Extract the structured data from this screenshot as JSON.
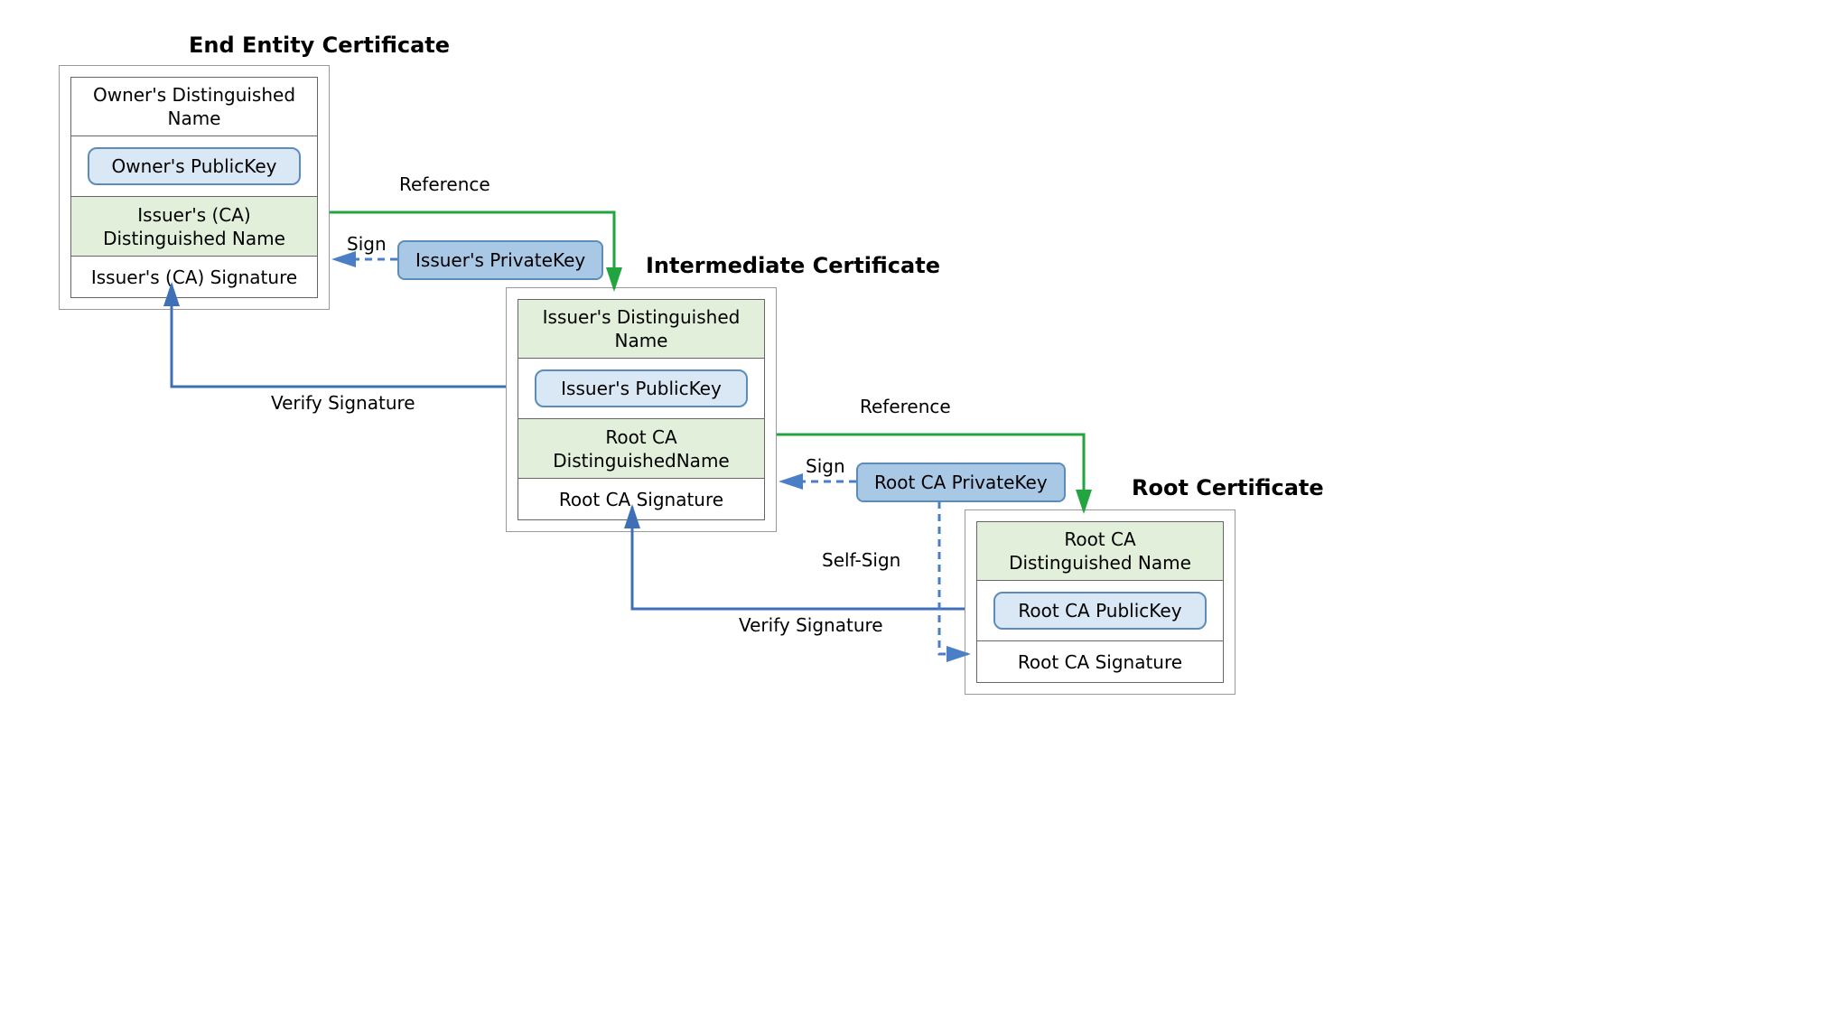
{
  "titles": {
    "endEntity": "End Entity Certificate",
    "intermediate": "Intermediate Certificate",
    "root": "Root Certificate"
  },
  "endEntity": {
    "ownerDN_l1": "Owner's Distinguished",
    "ownerDN_l2": "Name",
    "ownerPK": "Owner's PublicKey",
    "issuerDN_l1": "Issuer's (CA)",
    "issuerDN_l2": "Distinguished Name",
    "issuerSig": "Issuer's (CA) Signature"
  },
  "intermediate": {
    "issuerDN_l1": "Issuer's Distinguished",
    "issuerDN_l2": "Name",
    "issuerPK": "Issuer's PublicKey",
    "rootDN_l1": "Root CA",
    "rootDN_l2": "DistinguishedName",
    "rootSig": "Root CA Signature"
  },
  "root": {
    "rootDN_l1": "Root CA",
    "rootDN_l2": "Distinguished Name",
    "rootPK": "Root CA PublicKey",
    "rootSig": "Root CA Signature"
  },
  "keys": {
    "issuerPriv": "Issuer's PrivateKey",
    "rootPriv": "Root CA PrivateKey"
  },
  "labels": {
    "reference": "Reference",
    "sign": "Sign",
    "verify": "Verify Signature",
    "selfSign": "Self-Sign"
  }
}
